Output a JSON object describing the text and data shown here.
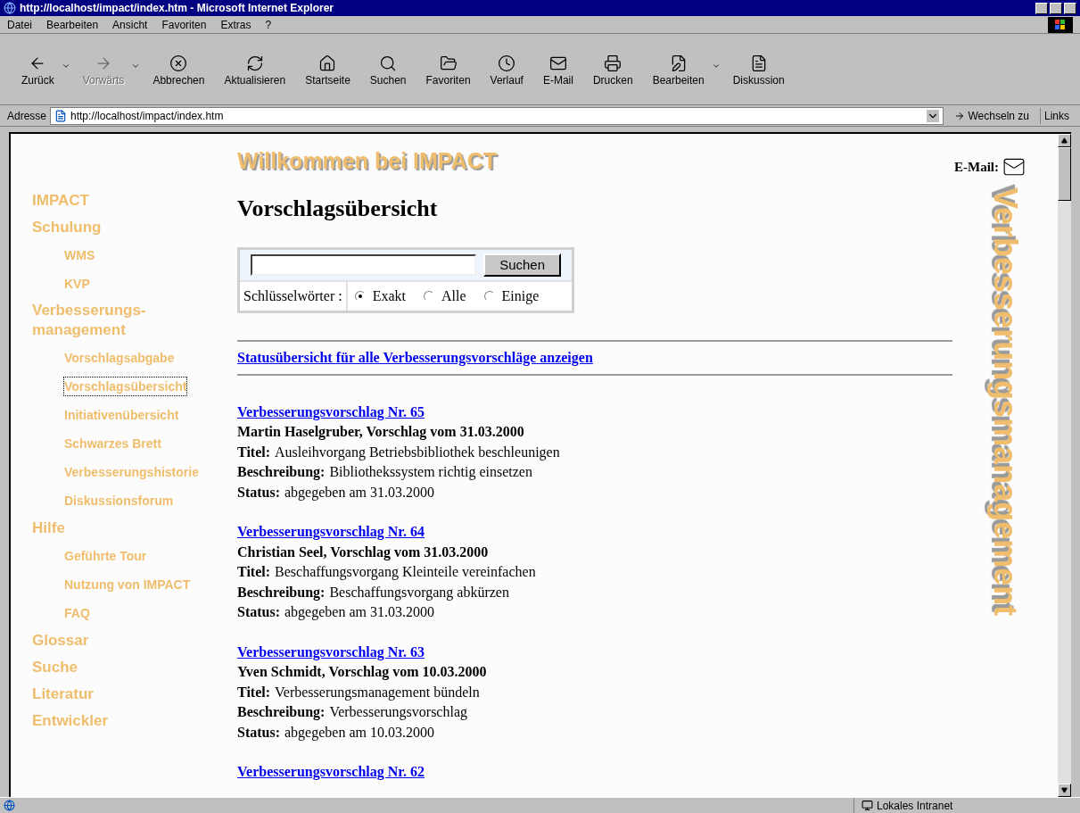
{
  "window": {
    "title": "http://localhost/impact/index.htm - Microsoft Internet Explorer"
  },
  "menu": [
    "Datei",
    "Bearbeiten",
    "Ansicht",
    "Favoriten",
    "Extras",
    "?"
  ],
  "toolbar": [
    {
      "label": "Zurück",
      "disabled": false,
      "dropdown": true
    },
    {
      "label": "Vorwärts",
      "disabled": true,
      "dropdown": true
    },
    {
      "label": "Abbrechen",
      "disabled": false,
      "dropdown": false
    },
    {
      "label": "Aktualisieren",
      "disabled": false,
      "dropdown": false
    },
    {
      "label": "Startseite",
      "disabled": false,
      "dropdown": false
    },
    {
      "label": "Suchen",
      "disabled": false,
      "dropdown": false
    },
    {
      "label": "Favoriten",
      "disabled": false,
      "dropdown": false
    },
    {
      "label": "Verlauf",
      "disabled": false,
      "dropdown": false
    },
    {
      "label": "E-Mail",
      "disabled": false,
      "dropdown": false
    },
    {
      "label": "Drucken",
      "disabled": false,
      "dropdown": false
    },
    {
      "label": "Bearbeiten",
      "disabled": false,
      "dropdown": true
    },
    {
      "label": "Diskussion",
      "disabled": false,
      "dropdown": false
    }
  ],
  "address_bar": {
    "label": "Adresse",
    "value": "http://localhost/impact/index.htm",
    "go_button": "Wechseln zu",
    "links": "Links"
  },
  "sidebar": {
    "items": [
      {
        "label": "IMPACT",
        "selected": false
      },
      {
        "label": "Schulung",
        "selected": false,
        "children": [
          {
            "label": "WMS",
            "selected": false
          },
          {
            "label": "KVP",
            "selected": false
          }
        ]
      },
      {
        "label": "Verbesserungs-management",
        "selected": false,
        "children": [
          {
            "label": "Vorschlagsabgabe",
            "selected": false
          },
          {
            "label": "Vorschlagsübersicht",
            "selected": true
          },
          {
            "label": "Initiativenübersicht",
            "selected": false
          },
          {
            "label": "Schwarzes Brett",
            "selected": false
          },
          {
            "label": "Verbesserungshistorie",
            "selected": false
          },
          {
            "label": "Diskussionsforum",
            "selected": false
          }
        ]
      },
      {
        "label": "Hilfe",
        "selected": false,
        "children": [
          {
            "label": "Geführte Tour",
            "selected": false
          },
          {
            "label": "Nutzung von IMPACT",
            "selected": false
          },
          {
            "label": "FAQ",
            "selected": false
          }
        ]
      },
      {
        "label": "Glossar",
        "selected": false
      },
      {
        "label": "Suche",
        "selected": false
      },
      {
        "label": "Literatur",
        "selected": false
      },
      {
        "label": "Entwickler",
        "selected": false
      }
    ]
  },
  "banner": "Willkommen bei IMPACT",
  "email_label": "E-Mail:",
  "vertical_title": "Verbesserungsmanagement",
  "heading": "Vorschlagsübersicht",
  "search": {
    "button": "Suchen",
    "keywords_label": "Schlüsselwörter :",
    "options": [
      {
        "label": "Exakt",
        "selected": true
      },
      {
        "label": "Alle",
        "selected": false
      },
      {
        "label": "Einige",
        "selected": false
      }
    ]
  },
  "status_link": "Statusübersicht für alle Verbesserungsvorschläge anzeigen",
  "proposals": [
    {
      "link": "Verbesserungsvorschlag Nr. 65",
      "author": "Martin Haselgruber, Vorschlag vom 31.03.2000",
      "fields": [
        {
          "label": "Titel:",
          "value": "Ausleihvorgang Betriebsbibliothek beschleunigen"
        },
        {
          "label": "Beschreibung:",
          "value": "Bibliothekssystem richtig einsetzen"
        },
        {
          "label": "Status:",
          "value": "abgegeben am 31.03.2000"
        }
      ]
    },
    {
      "link": "Verbesserungsvorschlag Nr. 64",
      "author": "Christian Seel, Vorschlag vom 31.03.2000",
      "fields": [
        {
          "label": "Titel:",
          "value": "Beschaffungsvorgang Kleinteile vereinfachen"
        },
        {
          "label": "Beschreibung:",
          "value": "Beschaffungsvorgang abkürzen"
        },
        {
          "label": "Status:",
          "value": "abgegeben am 31.03.2000"
        }
      ]
    },
    {
      "link": "Verbesserungsvorschlag Nr. 63",
      "author": "Yven Schmidt, Vorschlag vom 10.03.2000",
      "fields": [
        {
          "label": "Titel:",
          "value": "Verbesserungsmanagement bündeln"
        },
        {
          "label": "Beschreibung:",
          "value": "Verbesserungsvorschlag"
        },
        {
          "label": "Status:",
          "value": "abgegeben am 10.03.2000"
        }
      ]
    },
    {
      "link": "Verbesserungsvorschlag Nr. 62"
    }
  ],
  "status_bar": {
    "zone": "Lokales Intranet"
  }
}
